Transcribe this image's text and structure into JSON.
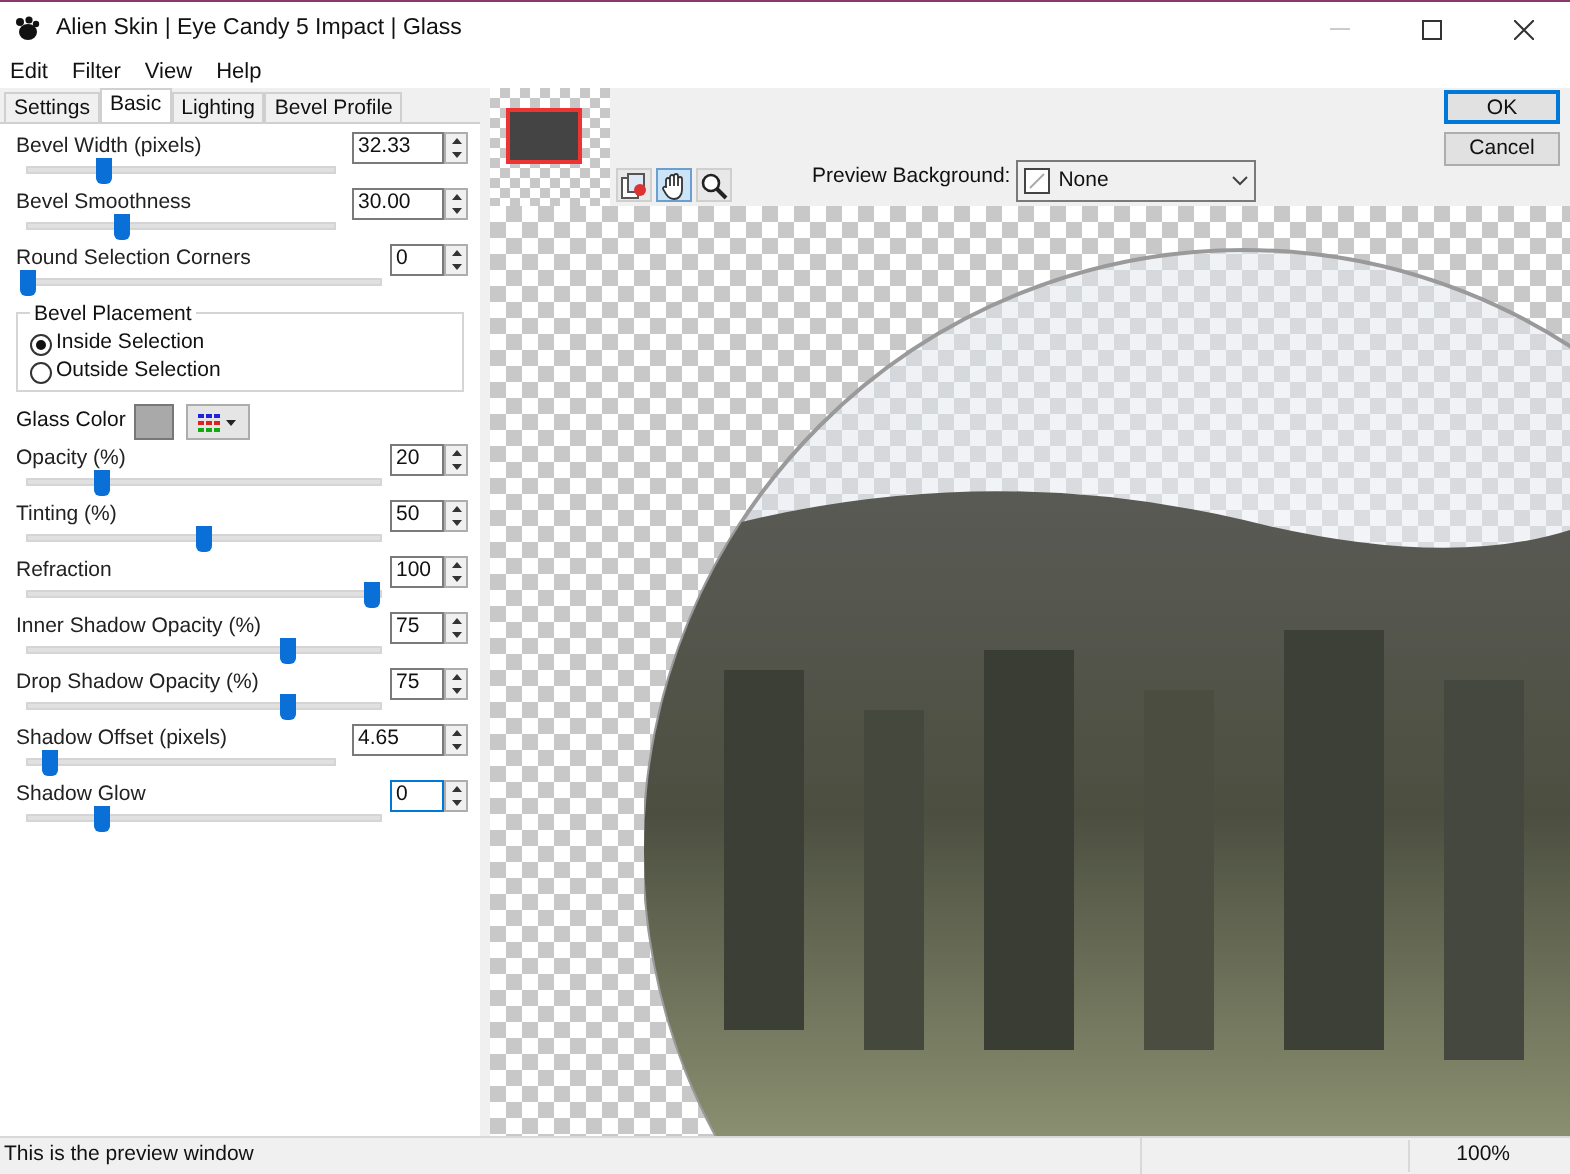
{
  "window": {
    "title": "Alien Skin | Eye Candy 5 Impact | Glass"
  },
  "menu": [
    "Edit",
    "Filter",
    "View",
    "Help"
  ],
  "tabs": [
    {
      "label": "Settings",
      "selected": false
    },
    {
      "label": "Basic",
      "selected": true
    },
    {
      "label": "Lighting",
      "selected": false
    },
    {
      "label": "Bevel Profile",
      "selected": false
    }
  ],
  "sliders_top": [
    {
      "label": "Bevel Width (pixels)",
      "value": "32.33",
      "level": 0.25,
      "focused": false
    },
    {
      "label": "Bevel Smoothness",
      "value": "30.00",
      "level": 0.31,
      "focused": false
    },
    {
      "label": "Round Selection Corners",
      "value": "0",
      "level": 0,
      "focused": false
    }
  ],
  "bevel_placement": {
    "title": "Bevel Placement",
    "options": [
      {
        "label": "Inside Selection",
        "selected": true
      },
      {
        "label": "Outside Selection",
        "selected": false
      }
    ]
  },
  "glass_color": {
    "label": "Glass Color",
    "color": "#a9a9a9"
  },
  "sliders": [
    {
      "label": "Opacity (%)",
      "value": "20",
      "level": 0.21,
      "focused": false
    },
    {
      "label": "Tinting (%)",
      "value": "50",
      "level": 0.5,
      "focused": false
    },
    {
      "label": "Refraction",
      "value": "100",
      "level": 0.98,
      "focused": false
    },
    {
      "label": "Inner Shadow Opacity (%)",
      "value": "75",
      "level": 0.74,
      "focused": false
    },
    {
      "label": "Drop Shadow Opacity (%)",
      "value": "75",
      "level": 0.74,
      "focused": false
    },
    {
      "label": "Shadow Offset (pixels)",
      "value": "4.65",
      "level": 0.07,
      "focused": false
    },
    {
      "label": "Shadow Glow",
      "value": "0",
      "level": 0.21,
      "focused": true
    }
  ],
  "tools": [
    {
      "kind": "preview",
      "selected": false
    },
    {
      "kind": "hand",
      "selected": true
    },
    {
      "kind": "zoom",
      "selected": false
    }
  ],
  "preview_background": {
    "label": "Preview Background:",
    "value": "None"
  },
  "buttons": [
    {
      "label": "OK",
      "default": true
    },
    {
      "label": "Cancel",
      "default": false
    }
  ],
  "status_bar": {
    "message": "This is the preview window",
    "zoom": "100%"
  }
}
